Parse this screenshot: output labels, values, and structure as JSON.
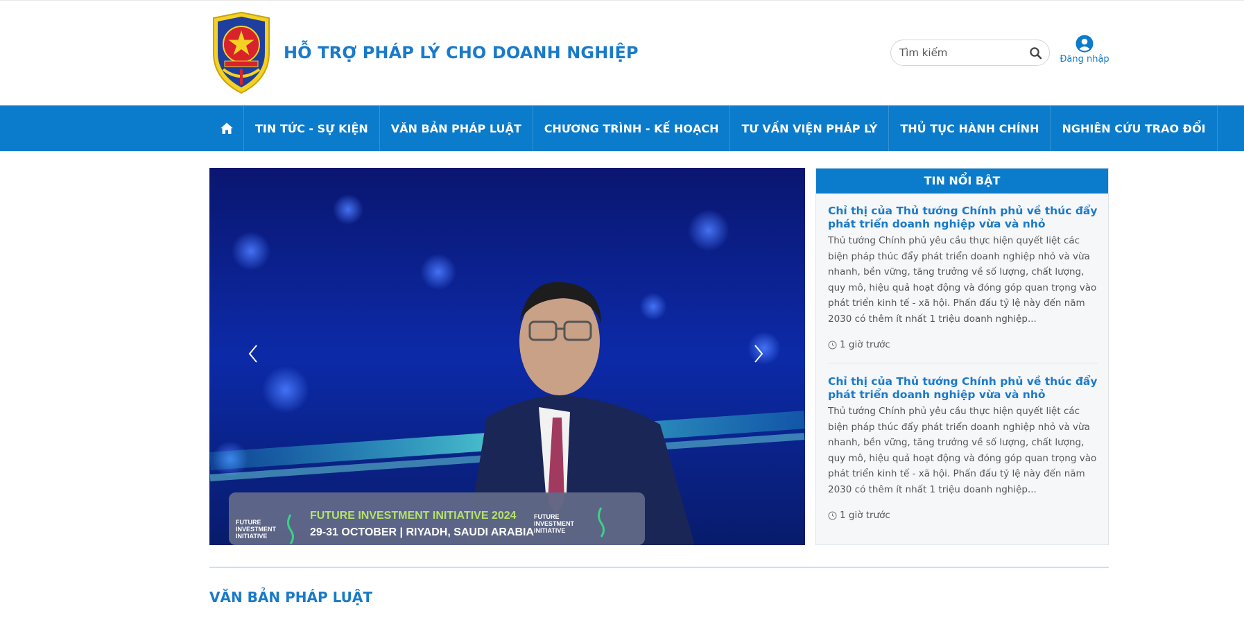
{
  "header": {
    "site_title": "HỖ TRỢ PHÁP LÝ CHO DOANH NGHIỆP",
    "logo_icon": "ministry-of-justice-emblem-icon",
    "search_placeholder": "Tìm kiếm",
    "search_icon": "search-icon",
    "login_label": "Đăng nhập",
    "login_icon": "user-circle-icon"
  },
  "nav": {
    "home_icon": "home-icon",
    "items": [
      {
        "label": "TIN TỨC - SỰ KIỆN"
      },
      {
        "label": "VĂN BẢN PHÁP LUẬT"
      },
      {
        "label": "CHƯƠNG TRÌNH - KẾ HOẠCH"
      },
      {
        "label": "TƯ VẤN VIỆN PHÁP LÝ"
      },
      {
        "label": "THỦ TỤC HÀNH CHÍNH"
      },
      {
        "label": "NGHIÊN CỨU TRAO ĐỔI"
      }
    ]
  },
  "slider": {
    "prev_icon": "chevron-left-icon",
    "next_icon": "chevron-right-icon"
  },
  "featured": {
    "heading": "TIN NỔI BẬT",
    "items": [
      {
        "title": "Chỉ thị của Thủ tướng Chính phủ về thúc đẩy phát triển doanh nghiệp vừa và nhỏ",
        "description": "Thủ tướng Chính phủ yêu cầu thực hiện quyết liệt các biện pháp thúc đẩy phát triển doanh nghiệp nhỏ và vừa nhanh, bền vững, tăng trưởng về số lượng, chất lượng, quy mô, hiệu quả hoạt động và đóng góp quan trọng vào phát triển kinh tế - xã hội. Phấn đấu tỷ lệ này đến năm 2030 có thêm ít nhất 1 triệu doanh nghiệp...",
        "time": "1 giờ trước"
      },
      {
        "title": "Chỉ thị của Thủ tướng Chính phủ về thúc đẩy phát triển doanh nghiệp vừa và nhỏ",
        "description": "Thủ tướng Chính phủ yêu cầu thực hiện quyết liệt các biện pháp thúc đẩy phát triển doanh nghiệp nhỏ và vừa nhanh, bền vững, tăng trưởng về số lượng, chất lượng, quy mô, hiệu quả hoạt động và đóng góp quan trọng vào phát triển kinh tế - xã hội. Phấn đấu tỷ lệ này đến năm 2030 có thêm ít nhất 1 triệu doanh nghiệp...",
        "time": "1 giờ trước"
      }
    ]
  },
  "section": {
    "title": "VĂN BẢN PHÁP LUẬT"
  },
  "colors": {
    "primary": "#0b7bcb",
    "title_blue": "#1a7ac9"
  }
}
